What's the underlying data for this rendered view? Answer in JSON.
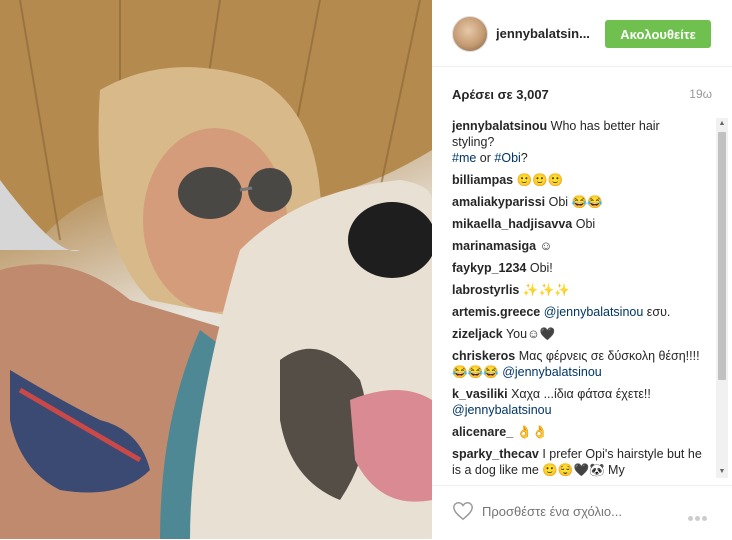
{
  "header": {
    "username": "jennybalatsin...",
    "follow_label": "Ακολουθείτε"
  },
  "post": {
    "likes": "Αρέσει σε 3,007",
    "time": "19ω"
  },
  "caption": {
    "user": "jennybalatsinou",
    "text": "Who has better hair styling?",
    "tag1": "#me",
    "or": " or ",
    "tag2": "#Obi",
    "q": "?"
  },
  "comments": [
    {
      "user": "billiampas",
      "text": "🙂🙂🙂"
    },
    {
      "user": "amaliakyparissi",
      "text": "Obi 😂😂"
    },
    {
      "user": "mikaella_hadjisavva",
      "text": "Obi"
    },
    {
      "user": "marinamasiga",
      "text": "☺"
    },
    {
      "user": "faykyp_1234",
      "text": "Obi!"
    },
    {
      "user": "labrostyrlis",
      "text": "✨✨✨"
    },
    {
      "user": "artemis.greece",
      "mention": "@jennybalatsinou",
      "text": "εσυ."
    },
    {
      "user": "zizeljack",
      "text": "You☺🖤"
    },
    {
      "user": "chriskeros",
      "text": "Μας φέρνεις σε δύσκολη θέση!!!!😂😂😂",
      "mention": "@jennybalatsinou"
    },
    {
      "user": "k_vasiliki",
      "text": "Χαχα ...ίδια φάτσα έχετε!!",
      "mention": "@jennybalatsinou"
    },
    {
      "user": "alicenare_",
      "text": "👌👌"
    },
    {
      "user": "sparky_thecav",
      "text": "I prefer Opi's hairstyle but he is a dog like me 🙂😌🖤🐼 My"
    }
  ],
  "footer": {
    "placeholder": "Προσθέστε ένα σχόλιο...",
    "heart_icon": "heart-outline-icon",
    "more_icon": "ellipsis-icon"
  }
}
